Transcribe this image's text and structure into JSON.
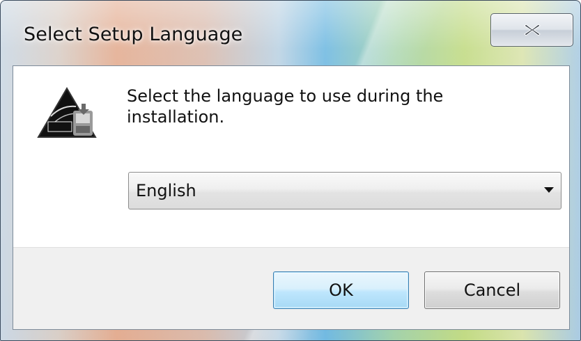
{
  "window": {
    "title": "Select Setup Language"
  },
  "titlebar": {
    "close_icon": "close-icon"
  },
  "dialog": {
    "app_icon": "setup-app-icon",
    "message_line1": "Select the language to use during the",
    "message_line2": "installation.",
    "language_select": {
      "selected": "English",
      "arrow_icon": "chevron-down-icon"
    }
  },
  "buttons": {
    "ok_label": "OK",
    "cancel_label": "Cancel"
  },
  "colors": {
    "ok_focus_border": "#3c7fb1",
    "footer_bg": "#f0f0f0"
  }
}
